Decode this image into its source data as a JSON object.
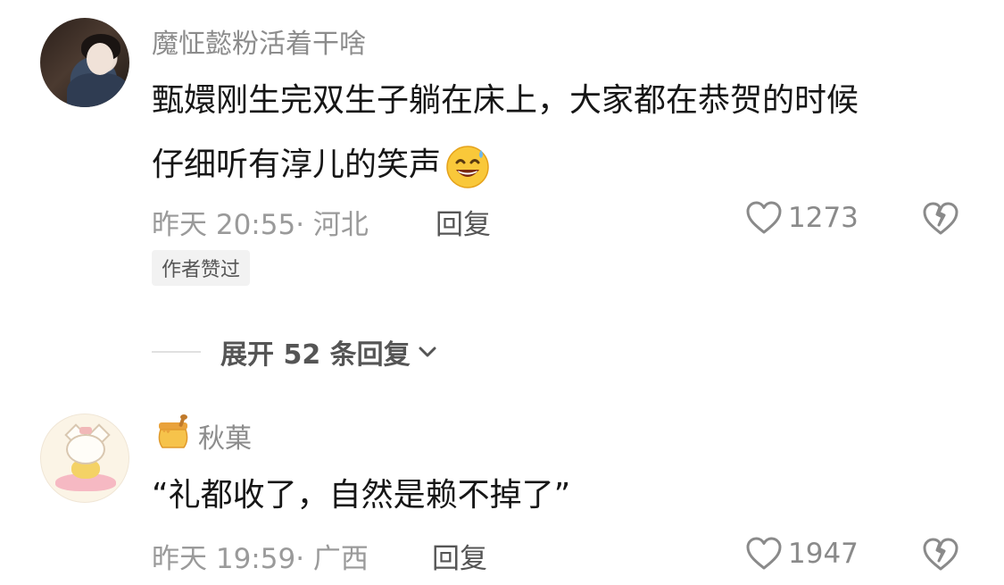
{
  "comments": [
    {
      "username": "魔怔懿粉活着干啥",
      "content_line1": "甄嬛刚生完双生子躺在床上，大家都在恭贺的时候",
      "content_line2": "仔细听有淳儿的笑声",
      "emoji": "grinning-sweat-emoji",
      "time_location": "昨天 20:55· 河北",
      "reply_label": "回复",
      "like_count": "1273",
      "author_tag": "作者赞过"
    },
    {
      "username": "秋菓",
      "username_badge": "honey-pot-icon",
      "content": "“礼都收了，自然是赖不掉了”",
      "time_location": "昨天 19:59· 广西",
      "reply_label": "回复",
      "like_count": "1947"
    }
  ],
  "expand_replies": {
    "label": "展开 52 条回复",
    "icon": "chevron-down-icon"
  }
}
